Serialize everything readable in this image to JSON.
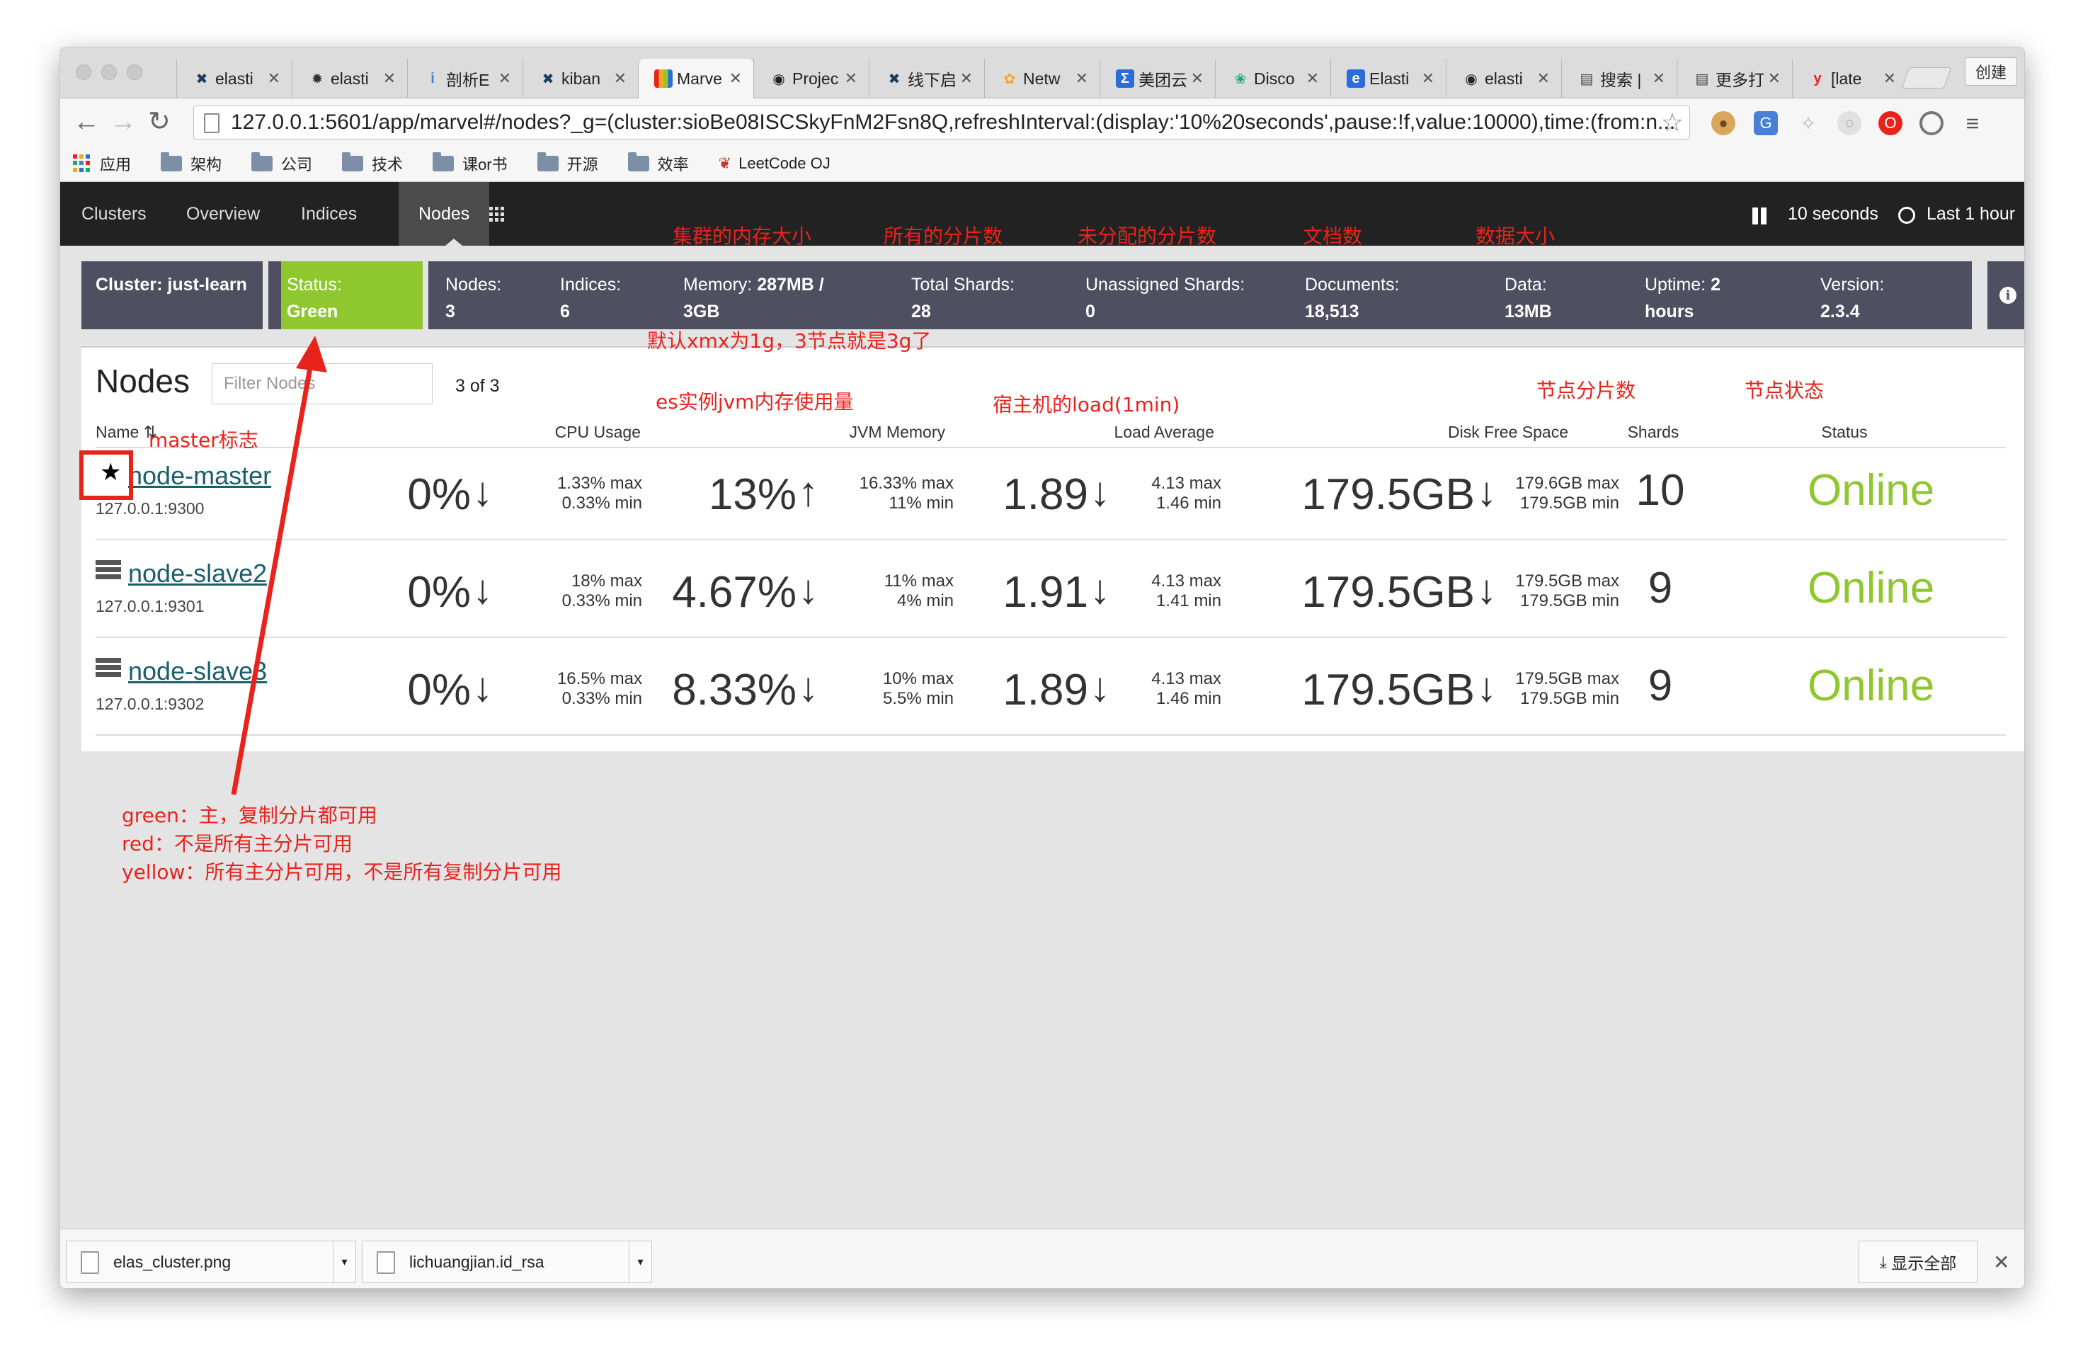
{
  "browser": {
    "tabs": [
      {
        "label": "elasti",
        "icon": "elastic-x-icon",
        "color": "#1a3d5c"
      },
      {
        "label": "elasti",
        "icon": "bug-icon",
        "color": "#333333"
      },
      {
        "label": "剖析E",
        "icon": "info-icon",
        "color": "#4a7fd8"
      },
      {
        "label": "kiban",
        "icon": "elastic-x-icon",
        "color": "#1a3d5c"
      },
      {
        "label": "Marve",
        "icon": "marvel-icon",
        "color": "#8fc72f"
      },
      {
        "label": "Projec",
        "icon": "github-icon",
        "color": "#222222"
      },
      {
        "label": "线下启",
        "icon": "elastic-x-icon",
        "color": "#1a3d5c"
      },
      {
        "label": "Netw",
        "icon": "network-icon",
        "color": "#f5a623"
      },
      {
        "label": "美团云",
        "icon": "sigma-icon",
        "color": "#2b6cd8"
      },
      {
        "label": "Disco",
        "icon": "discover-icon",
        "color": "#19a974"
      },
      {
        "label": "Elasti",
        "icon": "elastic-e-icon",
        "color": "#2b6cd8"
      },
      {
        "label": "elasti",
        "icon": "github-icon",
        "color": "#222222"
      },
      {
        "label": "搜索 |",
        "icon": "book-icon",
        "color": "#444444"
      },
      {
        "label": "更多打",
        "icon": "book-icon",
        "color": "#444444"
      },
      {
        "label": "[late",
        "icon": "y-icon",
        "color": "#e8231c"
      }
    ],
    "profile_label": "创建",
    "url": "127.0.0.1:5601/app/marvel#/nodes?_g=(cluster:sioBe08ISCSkyFnM2Fsn8Q,refreshInterval:(display:'10%20seconds',pause:!f,value:10000),time:(from:n...",
    "bookmarks": [
      {
        "label": "应用",
        "type": "apps"
      },
      {
        "label": "架构",
        "type": "folder"
      },
      {
        "label": "公司",
        "type": "folder"
      },
      {
        "label": "技术",
        "type": "folder"
      },
      {
        "label": "课or书",
        "type": "folder"
      },
      {
        "label": "开源",
        "type": "folder"
      },
      {
        "label": "效率",
        "type": "folder"
      },
      {
        "label": "LeetCode OJ",
        "type": "site"
      }
    ]
  },
  "kibana": {
    "nav": [
      "Clusters",
      "Overview",
      "Indices",
      "Nodes"
    ],
    "active_nav": "Nodes",
    "refresh_label": "10 seconds",
    "time_label": "Last 1 hour"
  },
  "status": {
    "cluster": "Cluster: just-learn",
    "status_label": "Status:",
    "status_value": "Green",
    "status_color": "#8fc72f",
    "nodes_label": "Nodes:",
    "nodes_value": "3",
    "indices_label": "Indices:",
    "indices_value": "6",
    "memory_label": "Memory:",
    "memory_value": "287MB / 3GB",
    "shards_label": "Total Shards:",
    "shards_value": "28",
    "unassigned_label": "Unassigned Shards:",
    "unassigned_value": "0",
    "documents_label": "Documents:",
    "documents_value": "18,513",
    "data_label": "Data:",
    "data_value": "13MB",
    "uptime_label": "Uptime:",
    "uptime_value": "2 hours",
    "version_label": "Version:",
    "version_value": "2.3.4"
  },
  "nodes_table": {
    "title": "Nodes",
    "filter_placeholder": "Filter Nodes",
    "count": "3 of 3",
    "headers": {
      "name": "Name",
      "cpu": "CPU Usage",
      "jvm": "JVM Memory",
      "load": "Load Average",
      "disk": "Disk Free Space",
      "shards": "Shards",
      "status": "Status"
    },
    "rows": [
      {
        "name": "node-master",
        "addr": "127.0.0.1:9300",
        "master": true,
        "cpu": "0%",
        "cpu_dir": "down",
        "cpu_max": "1.33% max",
        "cpu_min": "0.33% min",
        "jvm": "13%",
        "jvm_dir": "up",
        "jvm_max": "16.33% max",
        "jvm_min": "11% min",
        "load": "1.89",
        "load_dir": "down",
        "load_max": "4.13 max",
        "load_min": "1.46 min",
        "disk": "179.5GB",
        "disk_dir": "down",
        "disk_max": "179.6GB max",
        "disk_min": "179.5GB min",
        "shards": "10",
        "status": "Online"
      },
      {
        "name": "node-slave2",
        "addr": "127.0.0.1:9301",
        "master": false,
        "cpu": "0%",
        "cpu_dir": "down",
        "cpu_max": "18% max",
        "cpu_min": "0.33% min",
        "jvm": "4.67%",
        "jvm_dir": "down",
        "jvm_max": "11% max",
        "jvm_min": "4% min",
        "load": "1.91",
        "load_dir": "down",
        "load_max": "4.13 max",
        "load_min": "1.41 min",
        "disk": "179.5GB",
        "disk_dir": "down",
        "disk_max": "179.5GB max",
        "disk_min": "179.5GB min",
        "shards": "9",
        "status": "Online"
      },
      {
        "name": "node-slave3",
        "addr": "127.0.0.1:9302",
        "master": false,
        "cpu": "0%",
        "cpu_dir": "down",
        "cpu_max": "16.5% max",
        "cpu_min": "0.33% min",
        "jvm": "8.33%",
        "jvm_dir": "down",
        "jvm_max": "10% max",
        "jvm_min": "5.5% min",
        "load": "1.89",
        "load_dir": "down",
        "load_max": "4.13 max",
        "load_min": "1.46 min",
        "disk": "179.5GB",
        "disk_dir": "down",
        "disk_max": "179.5GB max",
        "disk_min": "179.5GB min",
        "shards": "9",
        "status": "Online"
      }
    ]
  },
  "downloads": {
    "items": [
      "elas_cluster.png",
      "lichuangjian.id_rsa"
    ],
    "show_all": "显示全部"
  },
  "annotations": {
    "cluster_memory": "集群的内存大小",
    "all_shards": "所有的分片数",
    "unassigned": "未分配的分片数",
    "docs": "文档数",
    "data_size": "数据大小",
    "xmx_note": "默认xmx为1g，3节点就是3g了",
    "jvm_note": "es实例jvm内存使用量",
    "load_note": "宿主机的load(1min)",
    "node_shards": "节点分片数",
    "node_status": "节点状态",
    "master_flag": "master标志",
    "legend_green": "green：主，复制分片都可用",
    "legend_red": "red：不是所有主分片可用",
    "legend_yellow": "yellow：所有主分片可用，不是所有复制分片可用",
    "color": "#e8231c"
  }
}
